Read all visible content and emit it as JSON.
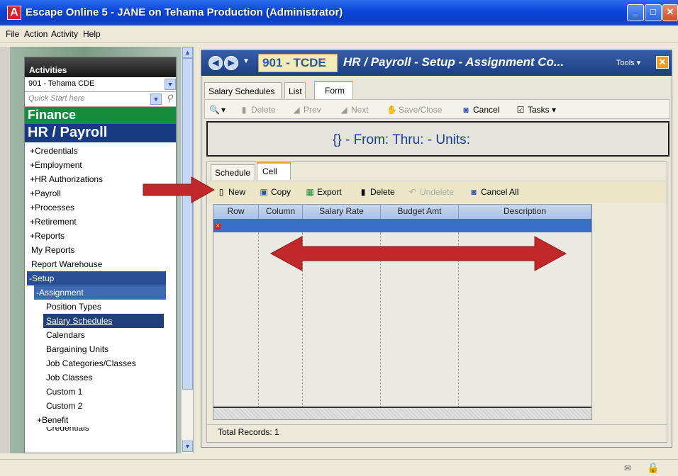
{
  "window": {
    "title": "Escape Online 5 - JANE on Tehama Production (Administrator)"
  },
  "menu": [
    "File",
    "Action",
    "Activity",
    "Help"
  ],
  "sidebar": {
    "header": "Activities",
    "district": "901 - Tehama CDE",
    "quick_start_placeholder": "Quick Start here",
    "finance": "Finance",
    "hr_payroll": "HR / Payroll",
    "items": [
      {
        "label": "+Credentials",
        "indent": 0
      },
      {
        "label": "+Employment",
        "indent": 0
      },
      {
        "label": "+HR Authorizations",
        "indent": 0
      },
      {
        "label": "+Payroll",
        "indent": 0
      },
      {
        "label": "+Processes",
        "indent": 0
      },
      {
        "label": "+Retirement",
        "indent": 0
      },
      {
        "label": "+Reports",
        "indent": 0
      },
      {
        "label": "My Reports",
        "indent": 0
      },
      {
        "label": "Report Warehouse",
        "indent": 0
      },
      {
        "label": "-Setup",
        "indent": 0
      },
      {
        "label": "-Assignment",
        "indent": 1
      },
      {
        "label": "Position Types",
        "indent": 2
      },
      {
        "label": "Salary Schedules",
        "indent": 2
      },
      {
        "label": "Calendars",
        "indent": 2
      },
      {
        "label": "Bargaining Units",
        "indent": 2
      },
      {
        "label": "Job Categories/Classes",
        "indent": 2
      },
      {
        "label": "Job Classes",
        "indent": 2
      },
      {
        "label": "Custom 1",
        "indent": 2
      },
      {
        "label": "Custom 2",
        "indent": 2
      },
      {
        "label": "+Benefit",
        "indent": 1
      },
      {
        "label": "Credentials",
        "indent": 1
      }
    ]
  },
  "main": {
    "code": "901 - TCDE",
    "title": "HR / Payroll - Setup - Assignment Co...",
    "tools_label": "Tools ▾",
    "tabs": [
      "Salary Schedules",
      "List",
      "Form"
    ],
    "toolbar": {
      "delete": "Delete",
      "prev": "Prev",
      "next": "Next",
      "save_close": "Save/Close",
      "cancel": "Cancel",
      "tasks": "Tasks"
    },
    "header_text": "{} - From: Thru: - Units:",
    "inner_tabs": [
      "Schedule",
      "Cell"
    ],
    "inner_toolbar": {
      "new": "New",
      "copy": "Copy",
      "export": "Export",
      "delete": "Delete",
      "undelete": "Undelete",
      "cancel_all": "Cancel All"
    },
    "grid_columns": [
      "Row",
      "Column",
      "Salary Rate",
      "Budget Amt",
      "Description"
    ],
    "total_records": "Total Records: 1"
  },
  "colors": {
    "title_blue": "#0a45d8",
    "finance_green": "#148c3c",
    "hr_blue": "#173b82",
    "annotation_red": "#c0282a"
  }
}
